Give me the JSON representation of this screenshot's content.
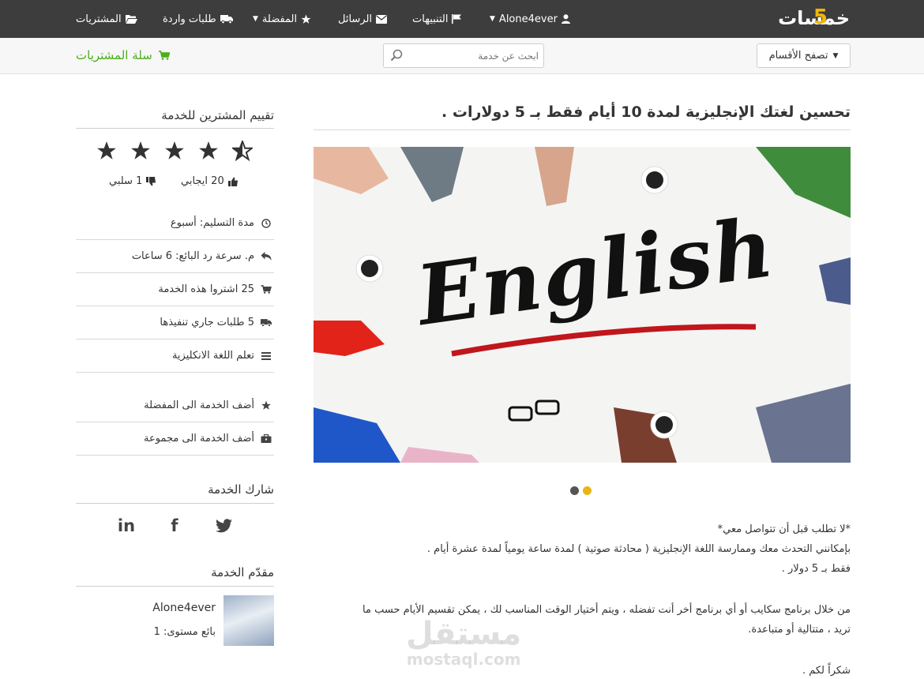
{
  "header": {
    "logo_text": "خمسات",
    "logo_numeral": "5",
    "user": "Alone4ever",
    "notifications": "التنبيهات",
    "messages": "الرسائل",
    "favorites": "المفضلة",
    "incoming_requests": "طلبات واردة",
    "purchases": "المشتريات"
  },
  "subbar": {
    "browse_label": "تصفح الأقسام",
    "search_placeholder": "ابحث عن خدمة",
    "cart_label": "سلة المشتريات"
  },
  "service": {
    "title": "تحسين لغتك الإنجليزية لمدة 10 أيام فقط بـ 5 دولارات .",
    "image_word": "English",
    "slider_dots": 2,
    "active_slide": 2,
    "description": [
      "*لا تطلب قبل أن تتواصل معي*",
      "بإمكانني التحدث معك وممارسة اللغة الإنجليزية ( محادثة صوتية ) لمدة ساعة يومياً لمدة عشرة أيام .",
      "فقط بـ 5 دولار .",
      "",
      "من خلال برنامج سكايب أو أي برنامج أخر أنت تفضله ، ويتم أختيار الوقت المناسب لك ، يمكن تقسيم الأيام حسب ما",
      "تريد ، متتالية أو متباعدة.",
      "",
      "شكراً لكم ."
    ]
  },
  "sidebar": {
    "rating_heading": "تقييم المشترين للخدمة",
    "rating_stars": 4.5,
    "rating_max": 5,
    "positive_label": "20 ايجابي",
    "negative_label": "1 سلبي",
    "info": [
      {
        "icon": "clock-icon",
        "label": "مدة التسليم: أسبوع"
      },
      {
        "icon": "reply-icon",
        "label": "م. سرعة رد البائع: 6 ساعات"
      },
      {
        "icon": "cart-icon",
        "label": "25 اشتروا هذه الخدمة"
      },
      {
        "icon": "truck-icon",
        "label": "5 طلبات جاري تنفيذها"
      },
      {
        "icon": "list-icon",
        "label": "تعلم اللغة الانكليزية"
      }
    ],
    "actions": [
      {
        "icon": "star-icon",
        "label": "أضف الخدمة الى المفضلة"
      },
      {
        "icon": "briefcase-icon",
        "label": "أضف الخدمة الى مجموعة"
      }
    ],
    "share_heading": "شارك الخدمة",
    "share_icons": [
      "linkedin-icon",
      "facebook-icon",
      "twitter-icon"
    ],
    "share_glyphs": [
      "in",
      "f",
      "t"
    ],
    "provider_heading": "مقدّم الخدمة",
    "provider_name": "Alone4ever",
    "provider_level": "بائع مستوى: 1"
  },
  "watermark": {
    "arabic": "مستقل",
    "latin": "mostaql.com"
  },
  "colors": {
    "topbar": "#3d3d3d",
    "accent_yellow": "#f2b705",
    "cart_green": "#4caf1a",
    "dot_inactive": "#555555",
    "dot_active": "#e8b514",
    "underline_red": "#c0161c"
  }
}
